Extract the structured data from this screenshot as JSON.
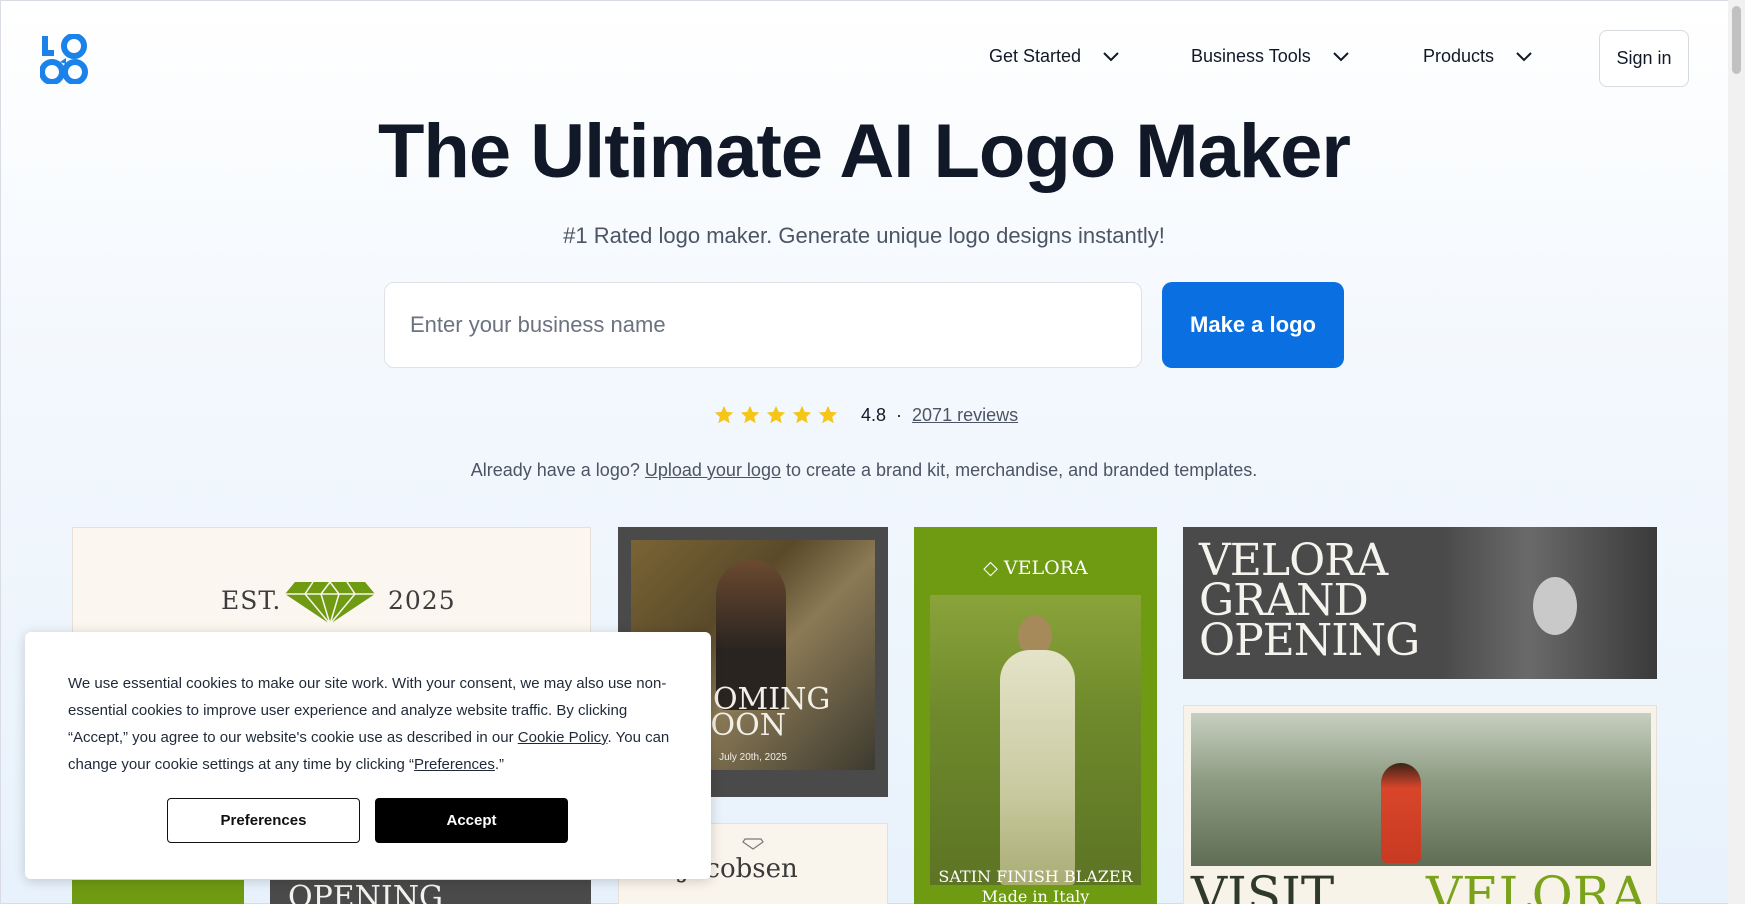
{
  "nav": {
    "items": [
      {
        "label": "Get Started"
      },
      {
        "label": "Business Tools"
      },
      {
        "label": "Products"
      }
    ],
    "signin_label": "Sign in"
  },
  "hero": {
    "title": "The Ultimate AI Logo Maker",
    "subtitle": "#1 Rated logo maker. Generate unique logo designs instantly!",
    "input_placeholder": "Enter your business name",
    "button_label": "Make a logo"
  },
  "rating": {
    "stars": 5,
    "value": "4.8",
    "separator": "·",
    "reviews_label": "2071 reviews",
    "star_color": "#f5c518"
  },
  "upload_line": {
    "prefix": "Already have a logo?",
    "link": "Upload your logo",
    "suffix": "to create a brand kit, merchandise, and branded templates."
  },
  "gallery": {
    "card1": {
      "est": "EST.",
      "year": "2025"
    },
    "card2": {
      "line1": "COMING",
      "line2": "SOON",
      "date": "July 20th, 2025"
    },
    "card2b": {
      "name": "na Jacobsen"
    },
    "card3": {
      "brand": "VELORA",
      "caption1": "SATIN FINISH BLAZER",
      "caption2": "Made in Italy"
    },
    "card4": {
      "line1": "VELORA",
      "line2": "GRAND",
      "line3": "OPENING"
    },
    "card5": {
      "left": "VISIT",
      "right": "VELORA"
    },
    "card7": {
      "text": "OPENING"
    }
  },
  "cookie": {
    "text_part1": "We use essential cookies to make our site work. With your consent, we may also use non-essential cookies to improve user experience and analyze website traffic. By clicking “Accept,” you agree to our website's cookie use as described in our",
    "policy_link": "Cookie Policy",
    "text_part2": ". You can change your cookie settings at any time by clicking “",
    "pref_link": "Preferences",
    "text_part3": ".”",
    "preferences_label": "Preferences",
    "accept_label": "Accept"
  },
  "colors": {
    "brand_blue": "#0a6fe0",
    "accent_green": "#6e9b12"
  }
}
